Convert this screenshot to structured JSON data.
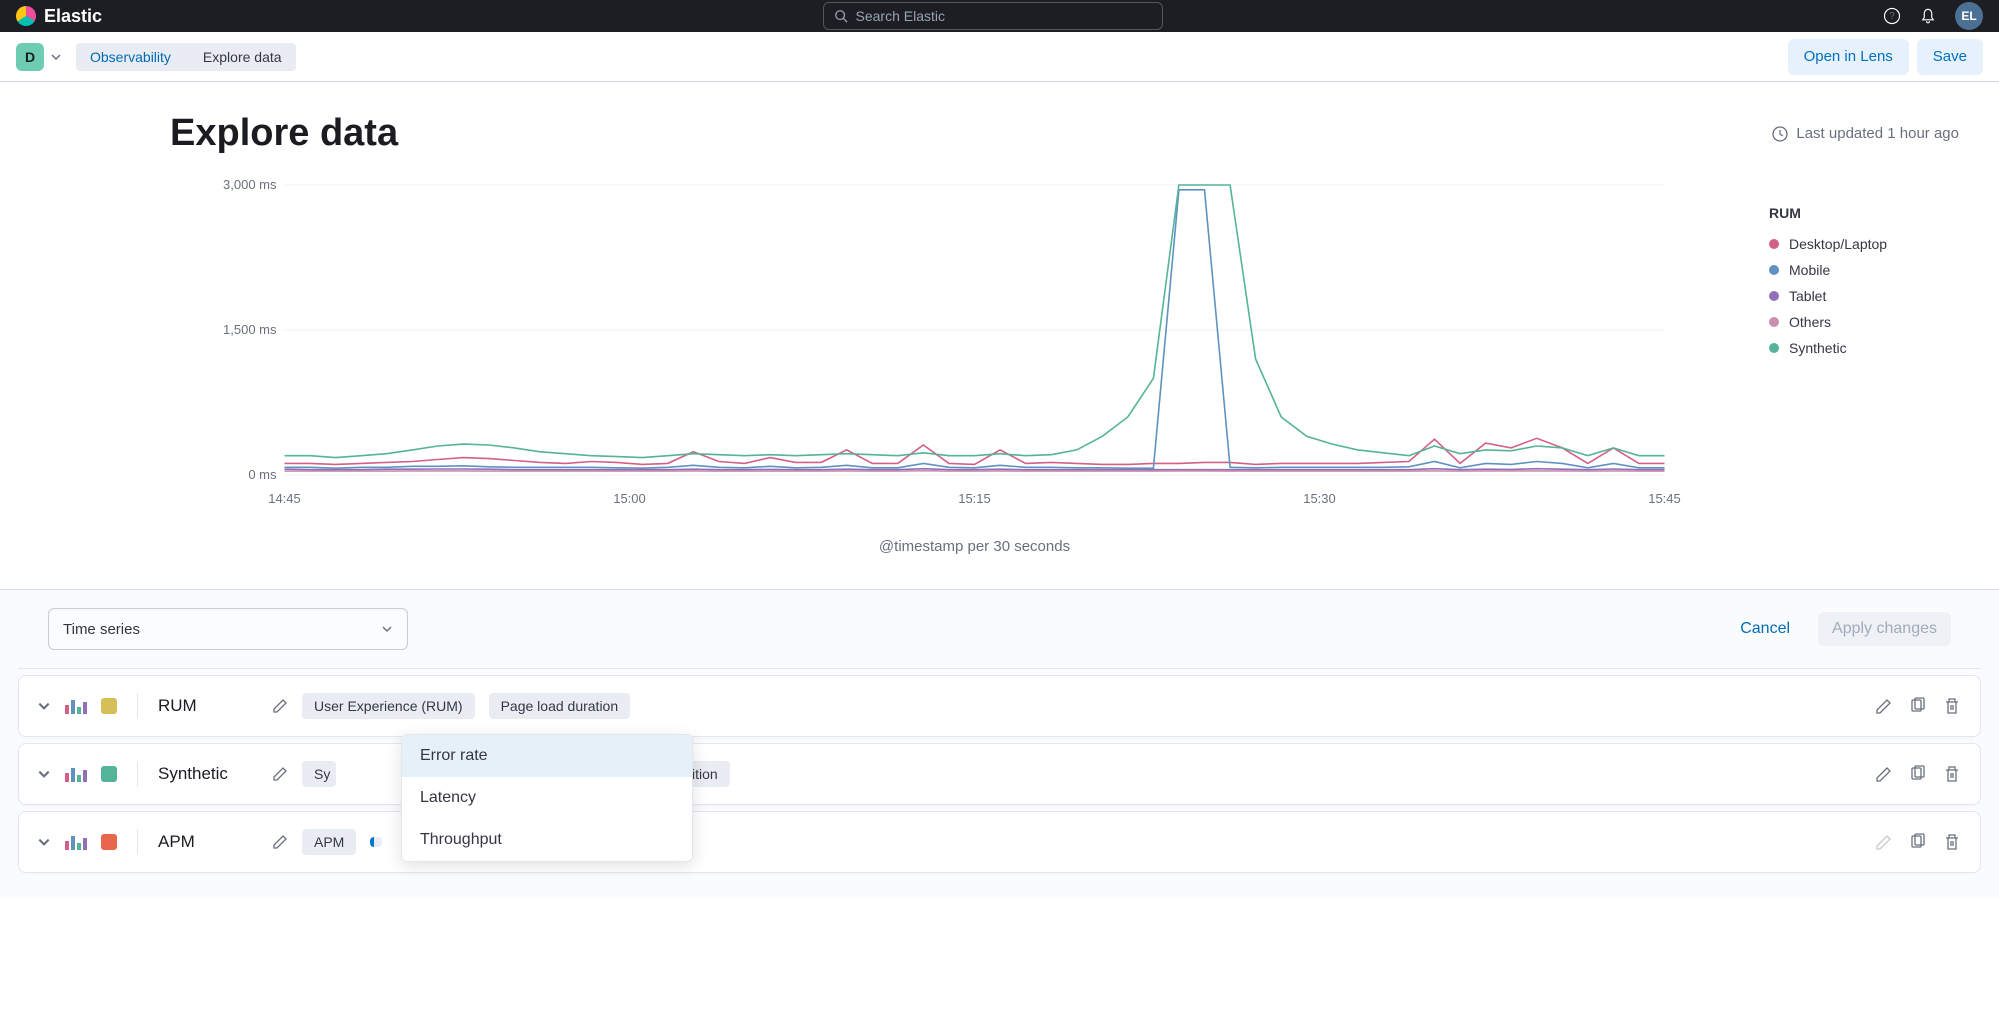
{
  "topbar": {
    "brand": "Elastic",
    "search_placeholder": "Search Elastic",
    "avatar_initials": "EL"
  },
  "breadcrumb": {
    "space_letter": "D",
    "items": [
      "Observability",
      "Explore data"
    ]
  },
  "actions": {
    "open_in_lens": "Open in Lens",
    "save": "Save"
  },
  "page": {
    "title": "Explore data",
    "last_updated": "Last updated 1 hour ago"
  },
  "chart_data": {
    "type": "line",
    "xlabel": "@timestamp per 30 seconds",
    "y_ticks": [
      "0 ms",
      "1,500 ms",
      "3,000 ms"
    ],
    "x_ticks": [
      "14:45",
      "15:00",
      "15:15",
      "15:30",
      "15:45"
    ],
    "ylim": [
      0,
      3000
    ],
    "series": [
      {
        "name": "Desktop/Laptop",
        "color": "#d36086",
        "values": [
          120,
          120,
          110,
          120,
          130,
          140,
          160,
          180,
          170,
          150,
          130,
          120,
          140,
          130,
          110,
          120,
          240,
          140,
          120,
          180,
          130,
          130,
          260,
          120,
          120,
          310,
          120,
          110,
          260,
          120,
          130,
          120,
          110,
          110,
          120,
          120,
          130,
          130,
          110,
          120,
          120,
          120,
          120,
          130,
          140,
          370,
          120,
          330,
          280,
          380,
          280,
          120,
          280,
          120,
          120
        ]
      },
      {
        "name": "Mobile",
        "color": "#6092c0",
        "values": [
          80,
          80,
          70,
          80,
          80,
          90,
          90,
          95,
          85,
          80,
          80,
          80,
          80,
          75,
          70,
          80,
          100,
          80,
          75,
          90,
          75,
          80,
          100,
          75,
          75,
          120,
          80,
          75,
          100,
          80,
          80,
          75,
          75,
          70,
          70,
          2950,
          2950,
          80,
          75,
          80,
          80,
          80,
          80,
          80,
          85,
          140,
          75,
          120,
          110,
          140,
          120,
          75,
          120,
          75,
          75
        ]
      },
      {
        "name": "Tablet",
        "color": "#9170b8",
        "values": [
          60,
          55,
          55,
          55,
          60,
          60,
          62,
          62,
          60,
          55,
          55,
          55,
          55,
          55,
          55,
          55,
          60,
          55,
          55,
          58,
          55,
          55,
          60,
          55,
          55,
          65,
          55,
          55,
          60,
          55,
          55,
          55,
          55,
          55,
          55,
          55,
          55,
          55,
          55,
          55,
          55,
          55,
          55,
          55,
          55,
          65,
          55,
          60,
          58,
          65,
          60,
          55,
          62,
          55,
          55
        ]
      },
      {
        "name": "Others",
        "color": "#ca8eae",
        "values": [
          40,
          40,
          40,
          40,
          40,
          42,
          42,
          42,
          40,
          40,
          40,
          40,
          40,
          40,
          40,
          40,
          42,
          40,
          40,
          40,
          40,
          40,
          42,
          40,
          40,
          44,
          40,
          40,
          42,
          40,
          40,
          40,
          40,
          40,
          40,
          42,
          42,
          40,
          40,
          40,
          40,
          40,
          40,
          40,
          40,
          42,
          40,
          42,
          42,
          42,
          42,
          40,
          42,
          40,
          40
        ]
      },
      {
        "name": "Synthetic",
        "color": "#54b399",
        "values": [
          200,
          200,
          180,
          200,
          220,
          260,
          300,
          320,
          310,
          280,
          240,
          220,
          200,
          190,
          180,
          200,
          220,
          210,
          200,
          210,
          200,
          210,
          220,
          210,
          200,
          230,
          200,
          200,
          220,
          200,
          210,
          260,
          400,
          600,
          1000,
          3100,
          3100,
          3100,
          1200,
          600,
          400,
          320,
          260,
          230,
          200,
          300,
          220,
          260,
          250,
          300,
          280,
          200,
          280,
          200,
          200
        ]
      }
    ],
    "legend": {
      "title": "RUM",
      "items": [
        {
          "label": "Desktop/Laptop",
          "color": "#d36086"
        },
        {
          "label": "Mobile",
          "color": "#6092c0"
        },
        {
          "label": "Tablet",
          "color": "#9170b8"
        },
        {
          "label": "Others",
          "color": "#ca8eae"
        },
        {
          "label": "Synthetic",
          "color": "#54b399"
        }
      ]
    }
  },
  "config": {
    "chart_type": "Time series",
    "cancel": "Cancel",
    "apply": "Apply changes",
    "rows": [
      {
        "color": "#d6bf57",
        "name": "RUM",
        "pills": [
          "User Experience (RUM)",
          "Page load duration"
        ]
      },
      {
        "color": "#54b399",
        "name": "Synthetic",
        "pills": [
          "Sy",
          "ition"
        ]
      },
      {
        "color": "#e7664c",
        "name": "APM",
        "pills": [
          "APM"
        ]
      }
    ],
    "dropdown": {
      "items": [
        "Error rate",
        "Latency",
        "Throughput"
      ],
      "selected": "Error rate"
    }
  }
}
